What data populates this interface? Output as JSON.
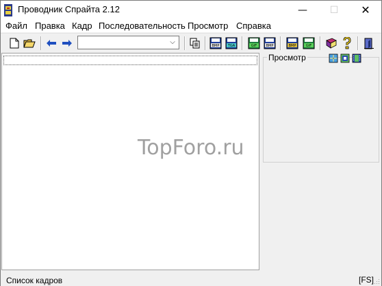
{
  "window": {
    "title": "Проводник Спрайта 2.12",
    "minimize_glyph": "—",
    "maximize_glyph": "☐",
    "close_glyph": "✕"
  },
  "menu": {
    "items": [
      "Файл",
      "Правка",
      "Кадр",
      "Последовательность",
      "Просмотр",
      "Справка"
    ]
  },
  "toolbar": {
    "combo_value": "",
    "buttons": [
      {
        "icon": "new-file-icon"
      },
      {
        "icon": "open-folder-icon"
      },
      {
        "icon": "arrow-left-icon"
      },
      {
        "icon": "arrow-right-icon"
      },
      {
        "icon": "copy-icon"
      },
      {
        "icon": "save-bmp-icon",
        "badge": "BMP"
      },
      {
        "icon": "save-tga-icon",
        "badge": "TGA"
      },
      {
        "icon": "save-gif-icon",
        "badge": "GIF"
      },
      {
        "icon": "save-bmp-sequence-icon",
        "badge": "BMP"
      },
      {
        "icon": "save-clipboard-icon",
        "badge": "BMP"
      },
      {
        "icon": "save-gif-anim-icon",
        "badge": "GIF"
      },
      {
        "icon": "book-icon"
      },
      {
        "icon": "help-icon"
      },
      {
        "icon": "exit-icon"
      }
    ]
  },
  "frame_list": {
    "watermark": "TopForo.ru"
  },
  "preview": {
    "label": "Просмотр",
    "buttons": [
      "zoom-icon",
      "fit-icon",
      "film-icon"
    ]
  },
  "status": {
    "left": "Список кадров",
    "right": "[FS]"
  },
  "colors": {
    "accent_blue": "#1f4fbf",
    "window_bg": "#f0f0f0"
  }
}
